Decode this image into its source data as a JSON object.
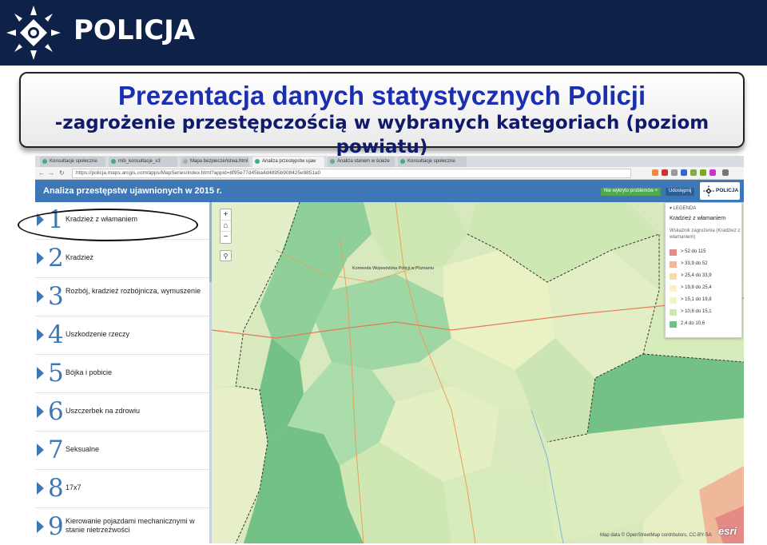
{
  "brand": {
    "name": "POLICJA"
  },
  "title": {
    "line1": "Prezentacja danych statystycznych Policji",
    "line2": "-zagrożenie przestępczością w wybranych kategoriach (poziom powiatu)"
  },
  "browser": {
    "tabs": [
      {
        "label": "Konsultacje społeczne"
      },
      {
        "label": "mib_konsultacje_v3"
      },
      {
        "label": "Mapa bezpieczeństwa.html"
      },
      {
        "label": "Analiza przestępstw ujaw"
      },
      {
        "label": "Analiza stanem w ścieże"
      },
      {
        "label": "Konsultacje społeczne"
      }
    ],
    "url": "https://policja.maps.arcgis.com/apps/MapSeries/index.html?appid=8f95e77d45ba4d4895b908425e9851a0"
  },
  "app": {
    "title": "Analiza przestępstw ujawnionych w 2015 r.",
    "report_button": "Nie wykryto problemów ×",
    "share_button": "Udostępnij",
    "logo_text": "POLICJA"
  },
  "sidebar": {
    "items": [
      {
        "num": "1",
        "label": "Kradzież z włamaniem"
      },
      {
        "num": "2",
        "label": "Kradzież"
      },
      {
        "num": "3",
        "label": "Rozbój, kradzież rozbójnicza, wymuszenie"
      },
      {
        "num": "4",
        "label": "Uszkodzenie rzeczy"
      },
      {
        "num": "5",
        "label": "Bójka i pobicie"
      },
      {
        "num": "6",
        "label": "Uszczerbek na zdrowiu"
      },
      {
        "num": "7",
        "label": "Seksualne"
      },
      {
        "num": "8",
        "label": "17x7"
      },
      {
        "num": "9",
        "label": "Kierowanie pojazdami mechanicznymi w stanie nietrzeźwości"
      }
    ]
  },
  "map": {
    "zoom_in": "+",
    "home": "⌂",
    "zoom_out": "−",
    "search": "⚲",
    "labels": {
      "hq": "Komenda Wojewódzka Policji w Poznaniu"
    },
    "attribution": "Map data © OpenStreetMap contributors, CC-BY-SA",
    "esri": "esri"
  },
  "legend": {
    "header": "▾ LEGENDA",
    "layer": "Kradzież z włamaniem",
    "subtitle": "Wskaźnik zagrożenia (Kradzież z włamaniem)",
    "classes": [
      {
        "label": "> 52 do 115",
        "color": "#e58a86"
      },
      {
        "label": "> 33,9 do 52",
        "color": "#f0b89a"
      },
      {
        "label": "> 25,4 do 33,9",
        "color": "#f7dcb0"
      },
      {
        "label": "> 19,8 do 25,4",
        "color": "#fbf0c6"
      },
      {
        "label": "> 15,1 do 19,8",
        "color": "#f3f5c9"
      },
      {
        "label": "> 10,6 do 15,1",
        "color": "#cfe7b3"
      },
      {
        "label": "2,4 do 10,6",
        "color": "#74c187"
      }
    ]
  }
}
